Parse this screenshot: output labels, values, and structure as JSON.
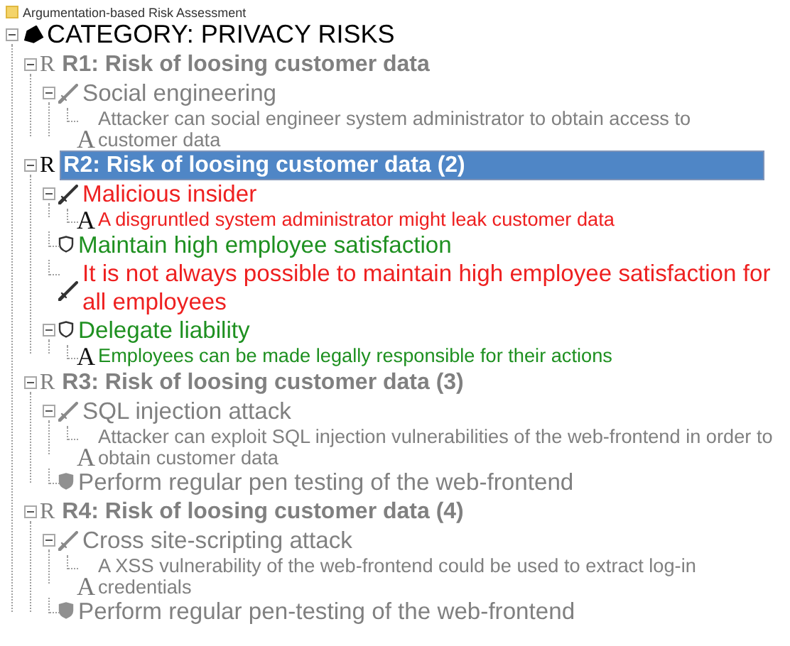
{
  "header": {
    "title": "Argumentation-based Risk Assessment"
  },
  "tree": {
    "kind": "category",
    "text": "CATEGORY: PRIVACY RISKS",
    "color": "#000000",
    "expanded": true,
    "children": [
      {
        "kind": "risk",
        "marker": "R",
        "text": "R1: Risk of loosing customer data",
        "color": "#808080",
        "selected": false,
        "expanded": true,
        "children": [
          {
            "kind": "attack",
            "text": "Social engineering",
            "color": "#808080",
            "expanded": true,
            "children": [
              {
                "kind": "argument",
                "marker": "A",
                "text": "Attacker can social engineer system administrator to obtain access to customer data",
                "color": "#808080"
              }
            ]
          }
        ]
      },
      {
        "kind": "risk",
        "marker": "R",
        "text": "R2: Risk of loosing customer data (2)",
        "color": "#000000",
        "selected": true,
        "expanded": true,
        "children": [
          {
            "kind": "attack",
            "text": "Malicious insider",
            "color": "#ee2020",
            "expanded": true,
            "children": [
              {
                "kind": "argument",
                "marker": "A",
                "text": "A disgruntled system administrator might leak customer data",
                "color": "#ee2020"
              }
            ]
          },
          {
            "kind": "defense",
            "text": "Maintain high employee satisfaction",
            "color": "#1e9020"
          },
          {
            "kind": "attack",
            "text": "It is not always possible to maintain high employee satisfaction for all employees",
            "color": "#ee2020"
          },
          {
            "kind": "defense",
            "text": "Delegate liability",
            "color": "#1e9020",
            "expanded": true,
            "children": [
              {
                "kind": "argument",
                "marker": "A",
                "text": "Employees can be made legally responsible for their actions",
                "color": "#1e9020"
              }
            ]
          }
        ]
      },
      {
        "kind": "risk",
        "marker": "R",
        "text": "R3: Risk of loosing customer data (3)",
        "color": "#808080",
        "selected": false,
        "expanded": true,
        "children": [
          {
            "kind": "attack",
            "text": "SQL injection attack",
            "color": "#808080",
            "expanded": true,
            "children": [
              {
                "kind": "argument",
                "marker": "A",
                "text": "Attacker can exploit SQL injection vulnerabilities of the web-frontend in order to obtain customer data",
                "color": "#808080"
              }
            ]
          },
          {
            "kind": "defense",
            "text": "Perform regular pen testing of the web-frontend",
            "color": "#808080"
          }
        ]
      },
      {
        "kind": "risk",
        "marker": "R",
        "text": "R4: Risk of loosing customer data (4)",
        "color": "#808080",
        "selected": false,
        "expanded": true,
        "children": [
          {
            "kind": "attack",
            "text": "Cross site-scripting attack",
            "color": "#808080",
            "expanded": true,
            "children": [
              {
                "kind": "argument",
                "marker": "A",
                "text": "A XSS vulnerability of the web-frontend could be used to extract log-in credentials",
                "color": "#808080"
              }
            ]
          },
          {
            "kind": "defense",
            "text": "Perform regular pen-testing of the web-frontend",
            "color": "#808080"
          }
        ]
      }
    ]
  }
}
